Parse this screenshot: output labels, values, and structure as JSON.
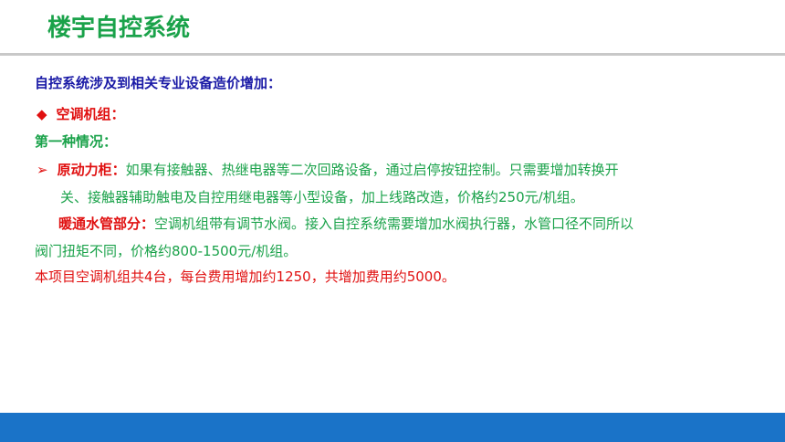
{
  "page": {
    "title": "楼宇自控系统"
  },
  "content": {
    "intro": "自控系统涉及到相关专业设备造价增加：",
    "section_bullet_glyph": "◆",
    "section_heading": "空调机组：",
    "case_heading": "第一种情况：",
    "item1_bullet_glyph": "➢",
    "item1_label": "原动力柜：",
    "item1_text_line1": "如果有接触器、热继电器等二次回路设备，通过启停按钮控制。只需要增加转换开",
    "item1_text_line2": "关、接触器辅助触电及自控用继电器等小型设备，加上线路改造，价格约250元/机组。",
    "item2_label": "暖通水管部分：",
    "item2_text_line1": "空调机组带有调节水阀。接入自控系统需要增加水阀执行器，水管口径不同所以",
    "item2_text_line2": "阀门扭矩不同，价格约800-1500元/机组。",
    "summary": "本项目空调机组共4台，每台费用增加约1250，共增加费用约5000。"
  },
  "colors": {
    "title_green": "#1aa24a",
    "intro_blue": "#1a1aa6",
    "accent_red": "#e01010",
    "text_green": "#1aa24a",
    "footer_blue": "#1a73c8",
    "rule_gray": "#c8c8c8"
  },
  "icons": {
    "section_bullet": "diamond-bullet-icon",
    "item_bullet": "arrow-bullet-icon"
  }
}
